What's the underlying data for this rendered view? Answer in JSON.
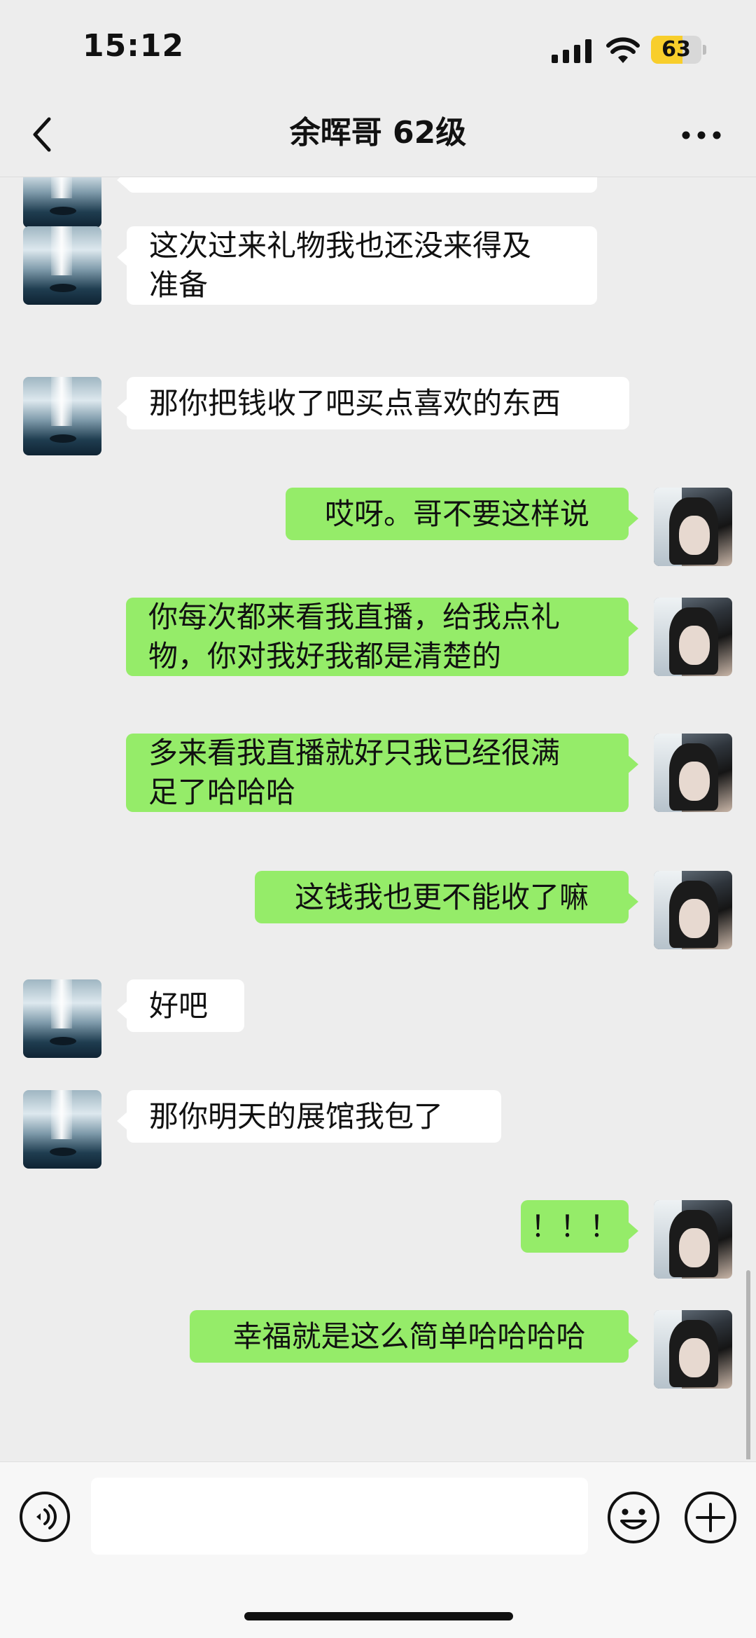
{
  "status_bar": {
    "time": "15:12",
    "battery_level": "63",
    "battery_fraction": 0.63,
    "battery_color": "#f8ce2b"
  },
  "nav": {
    "title": "余晖哥 62级",
    "back_icon": "chevron-left-icon",
    "more_icon": "more-dots-icon"
  },
  "messages": [
    {
      "side": "left",
      "lines": [
        "这次过来礼物我也还没来得及",
        "准备"
      ]
    },
    {
      "side": "left",
      "lines": [
        "那你把钱收了吧买点喜欢的东西"
      ]
    },
    {
      "side": "right",
      "lines": [
        "哎呀。哥不要这样说"
      ]
    },
    {
      "side": "right",
      "lines": [
        "你每次都来看我直播，给我点礼",
        "物，你对我好我都是清楚的"
      ]
    },
    {
      "side": "right",
      "lines": [
        "多来看我直播就好只我已经很满",
        "足了哈哈哈"
      ]
    },
    {
      "side": "right",
      "lines": [
        "这钱我也更不能收了嘛"
      ]
    },
    {
      "side": "left",
      "lines": [
        "好吧"
      ]
    },
    {
      "side": "left",
      "lines": [
        "那你明天的展馆我包了"
      ]
    },
    {
      "side": "right",
      "lines": [
        "！！！"
      ]
    },
    {
      "side": "right",
      "lines": [
        "幸福就是这么简单哈哈哈哈"
      ]
    }
  ],
  "input_bar": {
    "placeholder": "",
    "voice_icon": "voice-icon",
    "emoji_icon": "emoji-icon",
    "plus_icon": "plus-icon"
  },
  "colors": {
    "background": "#ededed",
    "self_bubble": "#95ec69",
    "peer_bubble": "#ffffff"
  }
}
